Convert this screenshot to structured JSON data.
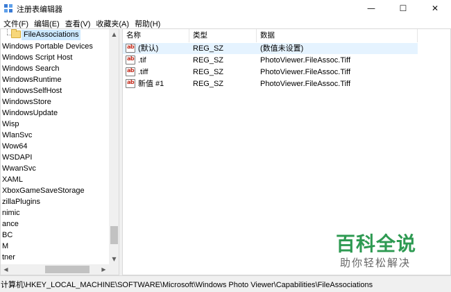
{
  "window": {
    "title": "注册表编辑器",
    "icon": "regedit-icon",
    "controls": {
      "minimize": "—",
      "maximize": "☐",
      "close": "✕"
    }
  },
  "menu": {
    "items": [
      "文件(F)",
      "编辑(E)",
      "查看(V)",
      "收藏夹(A)",
      "帮助(H)"
    ]
  },
  "tree": {
    "selected": "FileAssociations",
    "items": [
      "Windows Portable Devices",
      "Windows Script Host",
      "Windows Search",
      "WindowsRuntime",
      "WindowsSelfHost",
      "WindowsStore",
      "WindowsUpdate",
      "Wisp",
      "WlanSvc",
      "Wow64",
      "WSDAPI",
      "WwanSvc",
      "XAML",
      "XboxGameSaveStorage",
      "zillaPlugins",
      "nimic",
      "ance",
      "BC",
      "M",
      "tner"
    ],
    "vertical_scroll": {
      "up": "▲",
      "down": "▼"
    },
    "horizontal_scroll": {
      "left": "◀",
      "right": "▶"
    }
  },
  "values": {
    "columns": {
      "name": "名称",
      "type": "类型",
      "data": "数据"
    },
    "rows": [
      {
        "name": "(默认)",
        "type": "REG_SZ",
        "data": "(数值未设置)",
        "selected": true
      },
      {
        "name": ".tif",
        "type": "REG_SZ",
        "data": "PhotoViewer.FileAssoc.Tiff",
        "selected": false
      },
      {
        "name": ".tiff",
        "type": "REG_SZ",
        "data": "PhotoViewer.FileAssoc.Tiff",
        "selected": false
      },
      {
        "name": "新值 #1",
        "type": "REG_SZ",
        "data": " PhotoViewer.FileAssoc.Tiff",
        "selected": false
      }
    ],
    "icon_text": "ab"
  },
  "status": {
    "path": "计算机\\HKEY_LOCAL_MACHINE\\SOFTWARE\\Microsoft\\Windows Photo Viewer\\Capabilities\\FileAssociations"
  },
  "watermark": {
    "main": "百科全说",
    "sub": "助你轻松解决"
  },
  "colors": {
    "selection": "#cce8ff",
    "row_hover": "#e5f3ff",
    "watermark_green": "#2e9a52",
    "string_icon_red": "#c42b1c"
  }
}
